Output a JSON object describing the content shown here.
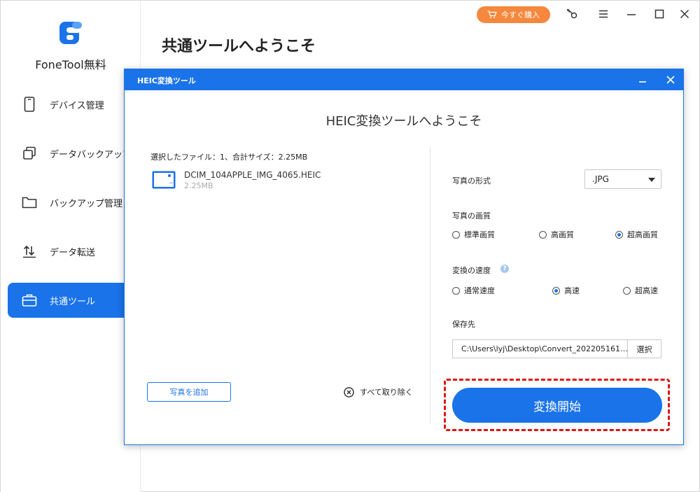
{
  "app": {
    "brand": "FoneTool無料",
    "buy_label": "今すぐ購入",
    "page_title": "共通ツールへようこそ"
  },
  "sidebar": {
    "items": [
      {
        "label": "デバイス管理",
        "icon": "phone-icon"
      },
      {
        "label": "データバックアップ",
        "icon": "copy-icon"
      },
      {
        "label": "バックアップ管理",
        "icon": "folder-icon"
      },
      {
        "label": "データ転送",
        "icon": "transfer-icon"
      },
      {
        "label": "共通ツール",
        "icon": "toolbox-icon",
        "active": true
      }
    ]
  },
  "dialog": {
    "title": "HEIC変換ツール",
    "heading": "HEIC変換ツールへようこそ",
    "files_summary": "選択したファイル：1、合計サイズ：2.25MB",
    "files": [
      {
        "name": "DCIM_104APPLE_IMG_4065.HEIC",
        "size": "2.25MB"
      }
    ],
    "add_photo_label": "写真を追加",
    "remove_all_label": "すべて取り除く",
    "format_label": "写真の形式",
    "format_value": ".JPG",
    "quality_label": "写真の画質",
    "quality_options": [
      {
        "label": "標準画質",
        "selected": false
      },
      {
        "label": "高画質",
        "selected": false
      },
      {
        "label": "超高画質",
        "selected": true
      }
    ],
    "speed_label": "変換の速度",
    "speed_options": [
      {
        "label": "通常速度",
        "selected": false
      },
      {
        "label": "高速",
        "selected": true
      },
      {
        "label": "超高速",
        "selected": false
      }
    ],
    "save_label": "保存先",
    "save_path": "C:\\Users\\lyj\\Desktop\\Convert_202205161…",
    "browse_label": "選択",
    "start_label": "変換開始"
  },
  "colors": {
    "accent": "#1a73e8",
    "buy": "#f5883d",
    "highlight": "#e01414"
  }
}
